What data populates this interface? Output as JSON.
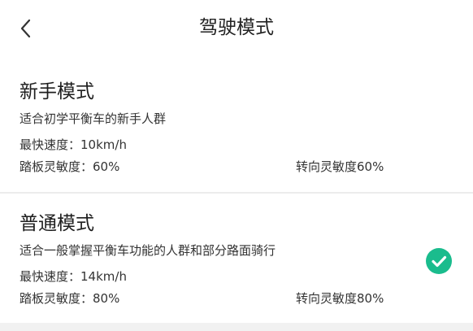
{
  "header": {
    "title": "驾驶模式",
    "back_icon": "chevron-left-icon"
  },
  "modes": [
    {
      "name": "新手模式",
      "description": "适合初学平衡车的新手人群",
      "max_speed": "最快速度：10km/h",
      "pedal_sensitivity": "踏板灵敏度：60%",
      "steering_sensitivity": "转向灵敏度60%",
      "selected": false
    },
    {
      "name": "普通模式",
      "description": "适合一般掌握平衡车功能的人群和部分路面骑行",
      "max_speed": "最快速度：14km/h",
      "pedal_sensitivity": "踏板灵敏度：80%",
      "steering_sensitivity": "转向灵敏度80%",
      "selected": true
    }
  ],
  "colors": {
    "accent": "#1abc8d",
    "background": "#ffffff",
    "divider": "#ececec"
  }
}
